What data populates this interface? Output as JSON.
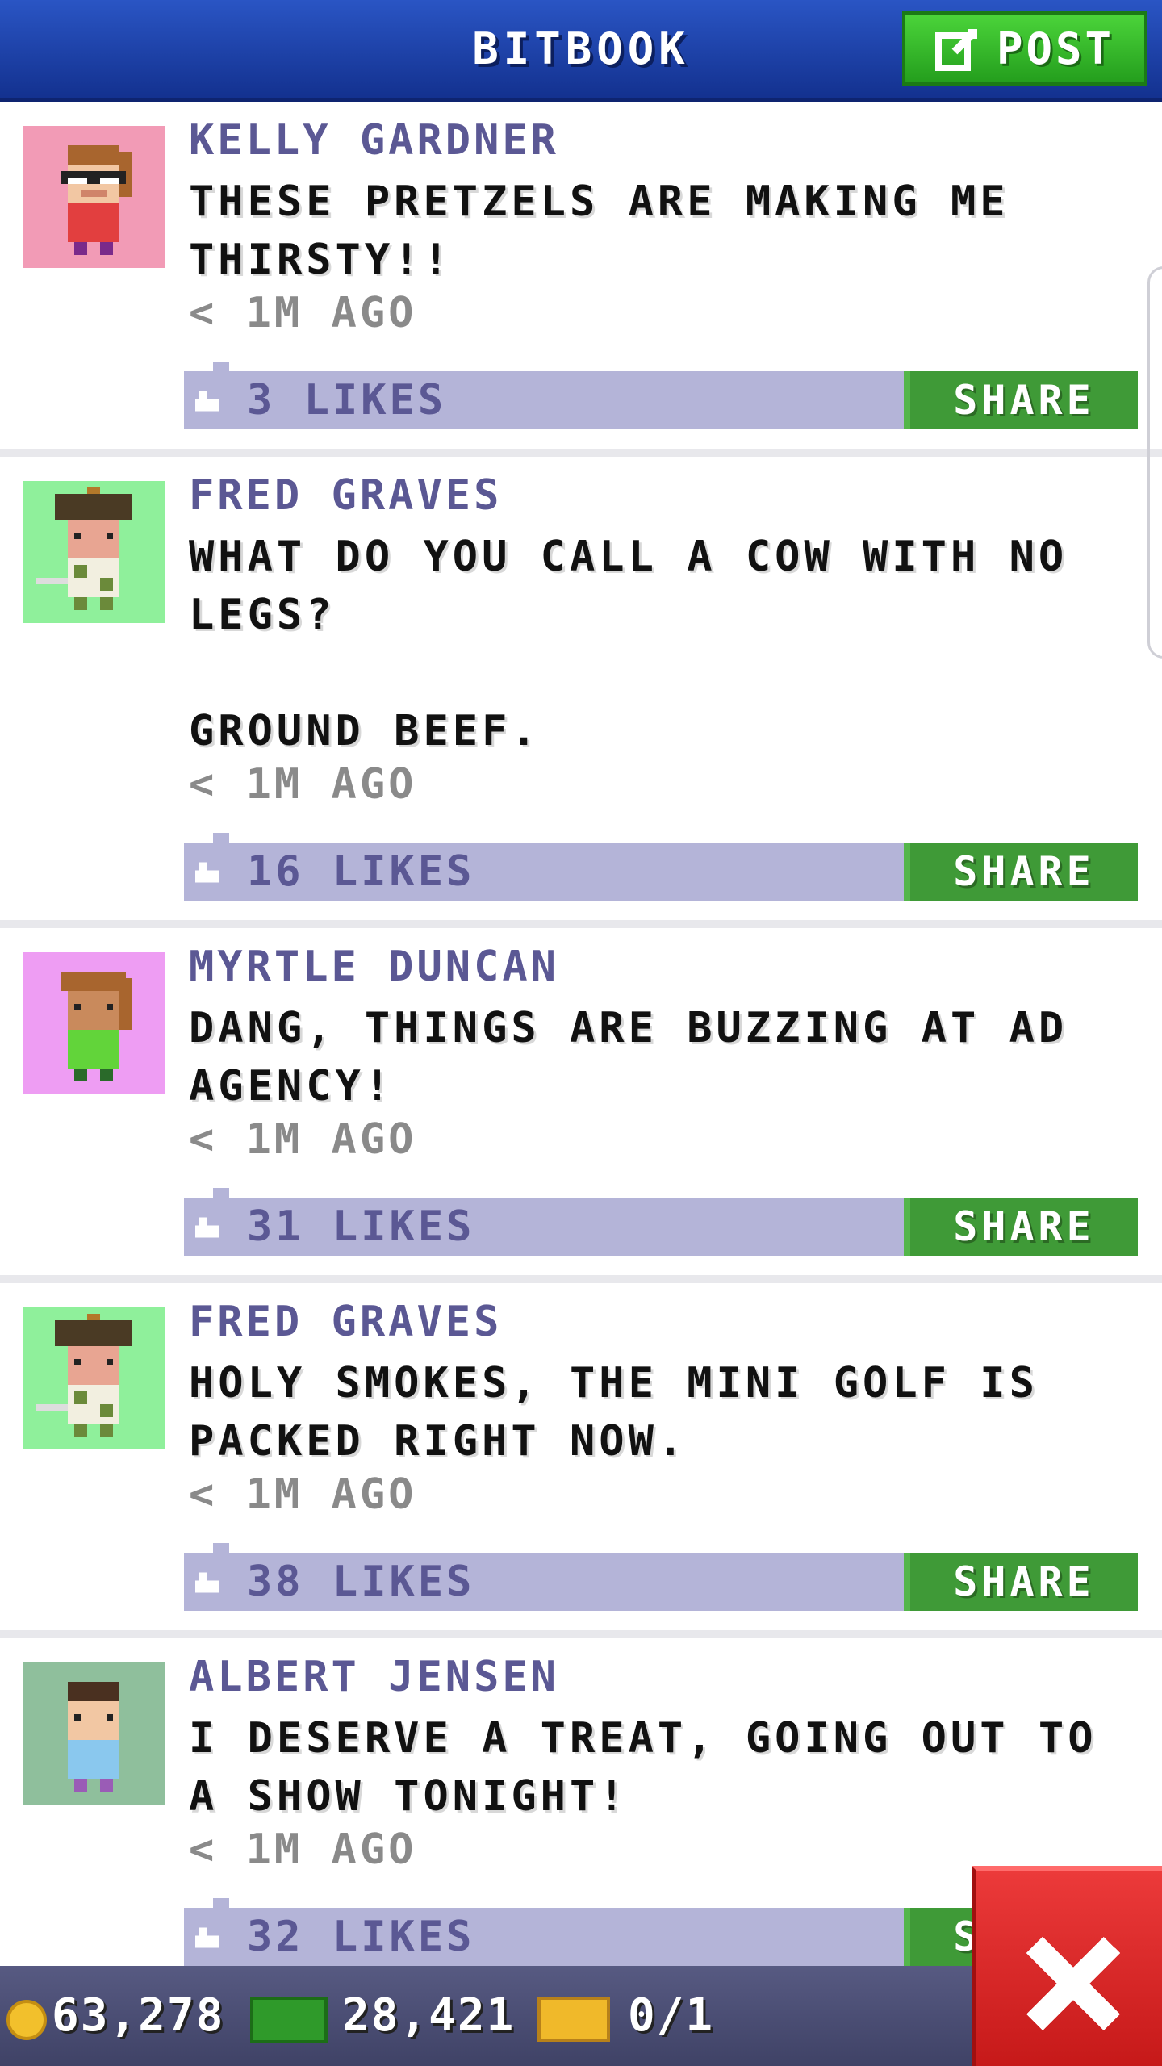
{
  "header": {
    "title": "BITBOOK",
    "post_label": "POST",
    "post_icon": "compose-icon"
  },
  "posts": [
    {
      "author": "KELLY GARDNER",
      "message": "THESE PRETZELS ARE MAKING ME THIRSTY!!",
      "time": "< 1M AGO",
      "likes": "3 LIKES",
      "share_label": "SHARE",
      "avatar_bg": "#f29bb6"
    },
    {
      "author": "FRED GRAVES",
      "message": "WHAT DO YOU CALL A COW WITH NO LEGS?\n\nGROUND BEEF.",
      "time": "< 1M AGO",
      "likes": "16 LIKES",
      "share_label": "SHARE",
      "avatar_bg": "#8ff09b"
    },
    {
      "author": "MYRTLE DUNCAN",
      "message": "DANG, THINGS ARE BUZZING AT AD AGENCY!",
      "time": "< 1M AGO",
      "likes": "31 LIKES",
      "share_label": "SHARE",
      "avatar_bg": "#ee9df3"
    },
    {
      "author": "FRED GRAVES",
      "message": "HOLY SMOKES, THE MINI GOLF IS PACKED RIGHT NOW.",
      "time": "< 1M AGO",
      "likes": "38 LIKES",
      "share_label": "SHARE",
      "avatar_bg": "#8ff09b"
    },
    {
      "author": "ALBERT JENSEN",
      "message": "I DESERVE A TREAT, GOING OUT TO A SHOW TONIGHT!",
      "time": "< 1M AGO",
      "likes": "32 LIKES",
      "share_label": "SHARE",
      "avatar_bg": "#8fbf9c"
    }
  ],
  "footer": {
    "coins": "63,278",
    "bux": "28,421",
    "tickets": "0/1"
  },
  "colors": {
    "header": "#1e44aa",
    "post_button": "#3cb831",
    "likes_bar": "#b4b4d8",
    "share": "#3f9a37",
    "close": "#dc2a2a"
  }
}
